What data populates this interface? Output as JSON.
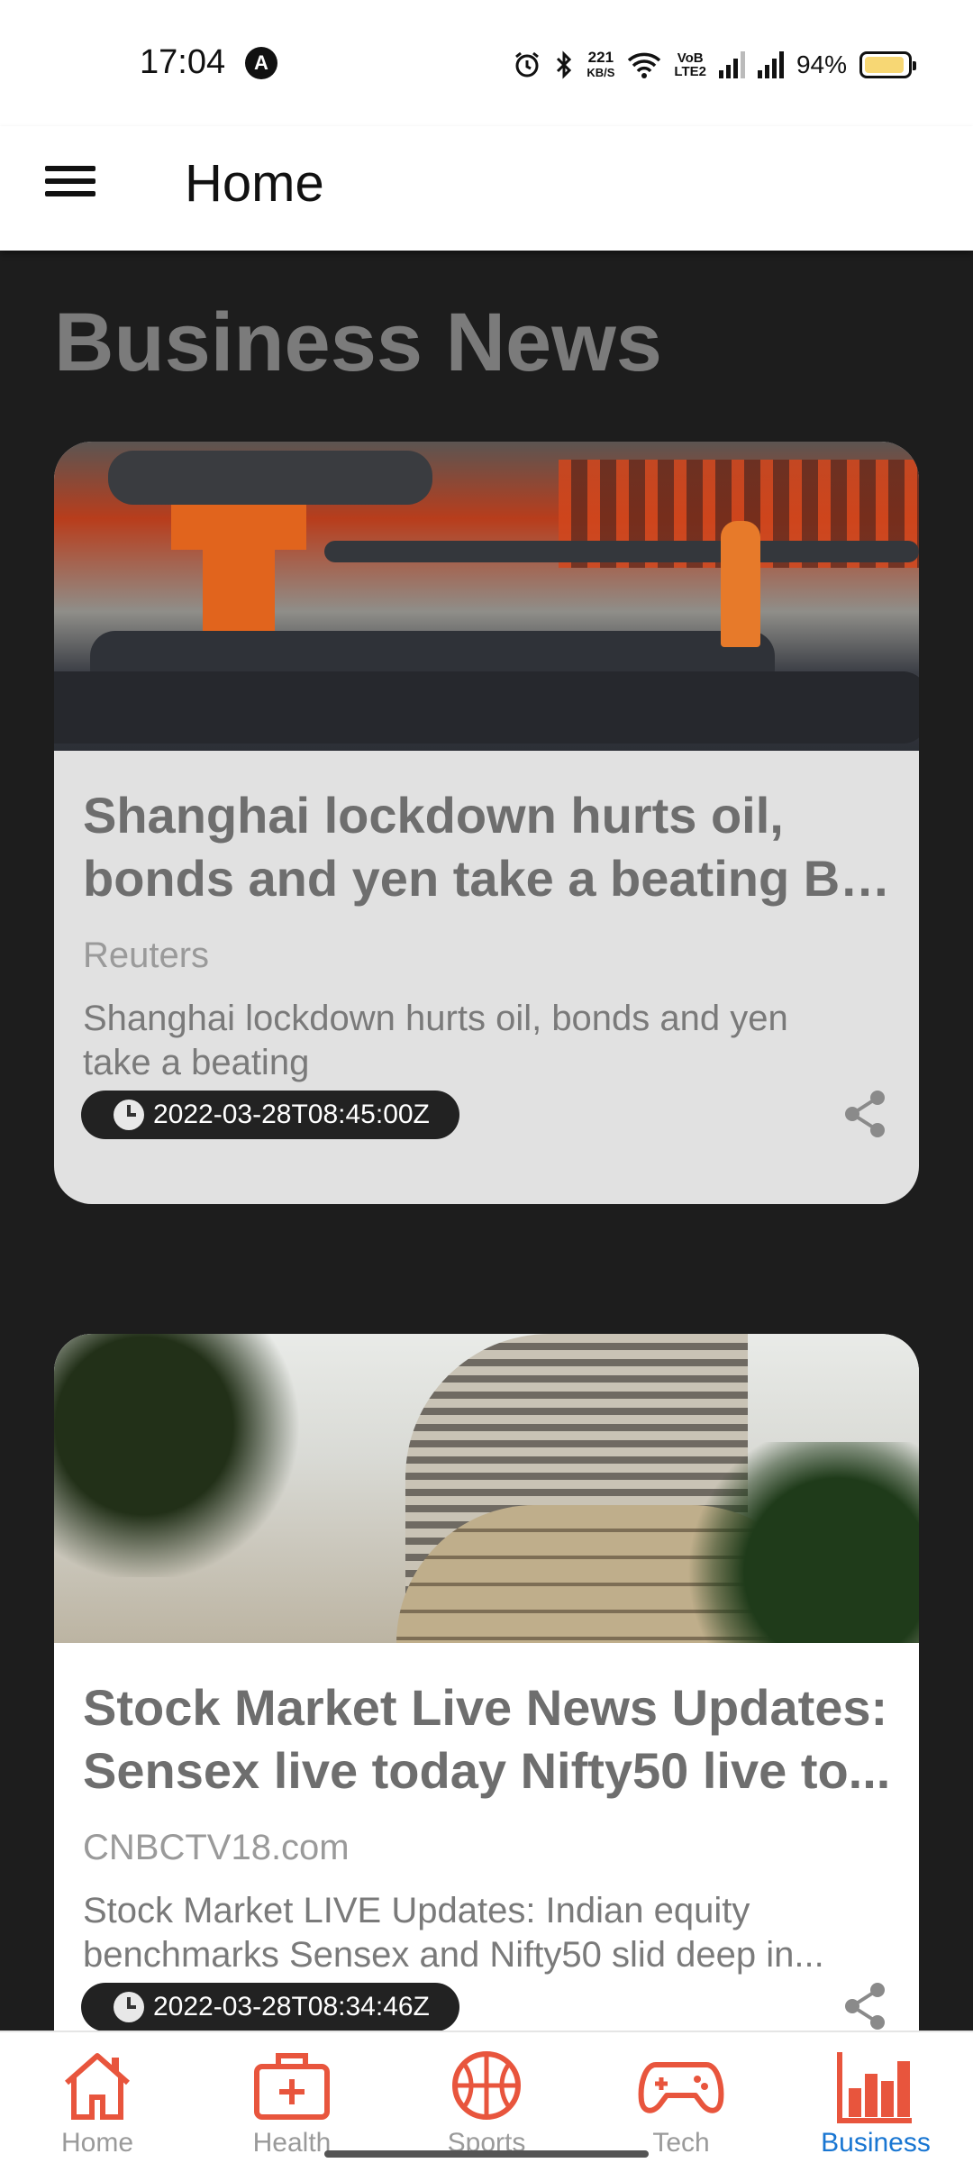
{
  "status_bar": {
    "time": "17:04",
    "app_badge": "A",
    "net_speed": "221",
    "net_unit": "KB/S",
    "vo_lte": "VoB",
    "lte": "LTE2",
    "battery_percent": "94%",
    "battery_level": 0.94,
    "battery_color": "#f7d774"
  },
  "app_bar": {
    "title": "Home",
    "menu_icon": "hamburger-menu-icon"
  },
  "main": {
    "section_title": "Business News",
    "articles": [
      {
        "title_line1": "Shanghai lockdown hurts oil,",
        "title_line2": "bonds and yen take a beating By ...",
        "source": "Reuters",
        "description_line1": "Shanghai lockdown hurts oil, bonds and yen",
        "description_line2": "take a beating",
        "published_at": "2022-03-28T08:45:00Z",
        "image": "oil pipeline industrial site",
        "card_color": "#e1e1e1"
      },
      {
        "title_line1": "Stock Market Live News Updates:",
        "title_line2": "Sensex live today Nifty50 live to...",
        "source": "CNBCTV18.com",
        "description_line1": "Stock Market LIVE Updates: Indian equity",
        "description_line2": "benchmarks Sensex and Nifty50 slid deep in...",
        "published_at": "2022-03-28T08:34:46Z",
        "image": "Bombay Stock Exchange building",
        "card_color": "#ffffff"
      }
    ]
  },
  "bottom_nav": {
    "items": [
      {
        "label": "Home",
        "icon": "house-icon",
        "active": false
      },
      {
        "label": "Health",
        "icon": "medical-kit-icon",
        "active": false
      },
      {
        "label": "Sports",
        "icon": "basketball-icon",
        "active": false
      },
      {
        "label": "Tech",
        "icon": "gamepad-icon",
        "active": false
      },
      {
        "label": "Business",
        "icon": "bar-chart-icon",
        "active": true
      }
    ],
    "icon_color": "#e8553d",
    "active_label_color": "#1976d2"
  }
}
